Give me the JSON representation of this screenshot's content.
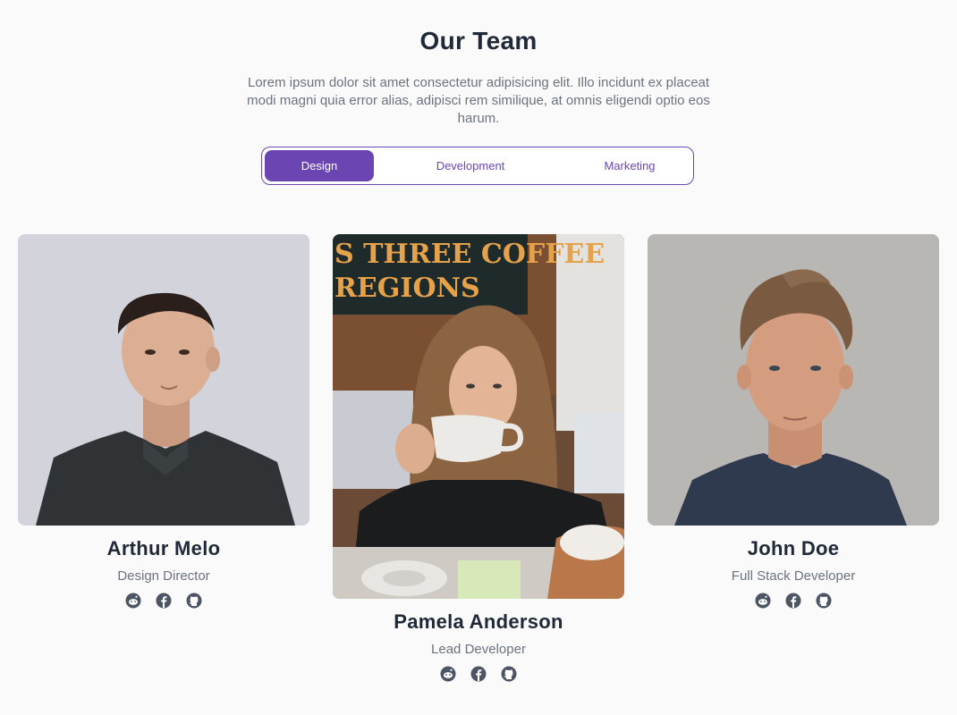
{
  "header": {
    "title": "Our Team",
    "intro": "Lorem ipsum dolor sit amet consectetur adipisicing elit. Illo incidunt ex placeat modi magni quia error alias, adipisci rem similique, at omnis eligendi optio eos harum."
  },
  "tabs": [
    {
      "label": "Design",
      "active": true
    },
    {
      "label": "Development",
      "active": false
    },
    {
      "label": "Marketing",
      "active": false
    }
  ],
  "members": [
    {
      "name": "Arthur Melo",
      "role": "Design Director"
    },
    {
      "name": "Pamela Anderson",
      "role": "Lead Developer"
    },
    {
      "name": "John Doe",
      "role": "Full Stack Developer"
    }
  ],
  "photo_signs": {
    "line1": "S THREE COFFEE",
    "line2": "REGIONS"
  },
  "social_icons": [
    "reddit-icon",
    "facebook-icon",
    "github-icon"
  ],
  "colors": {
    "accent": "#6b46b3",
    "title": "#1f2937",
    "muted": "#6b7280",
    "background": "#fafafa"
  }
}
